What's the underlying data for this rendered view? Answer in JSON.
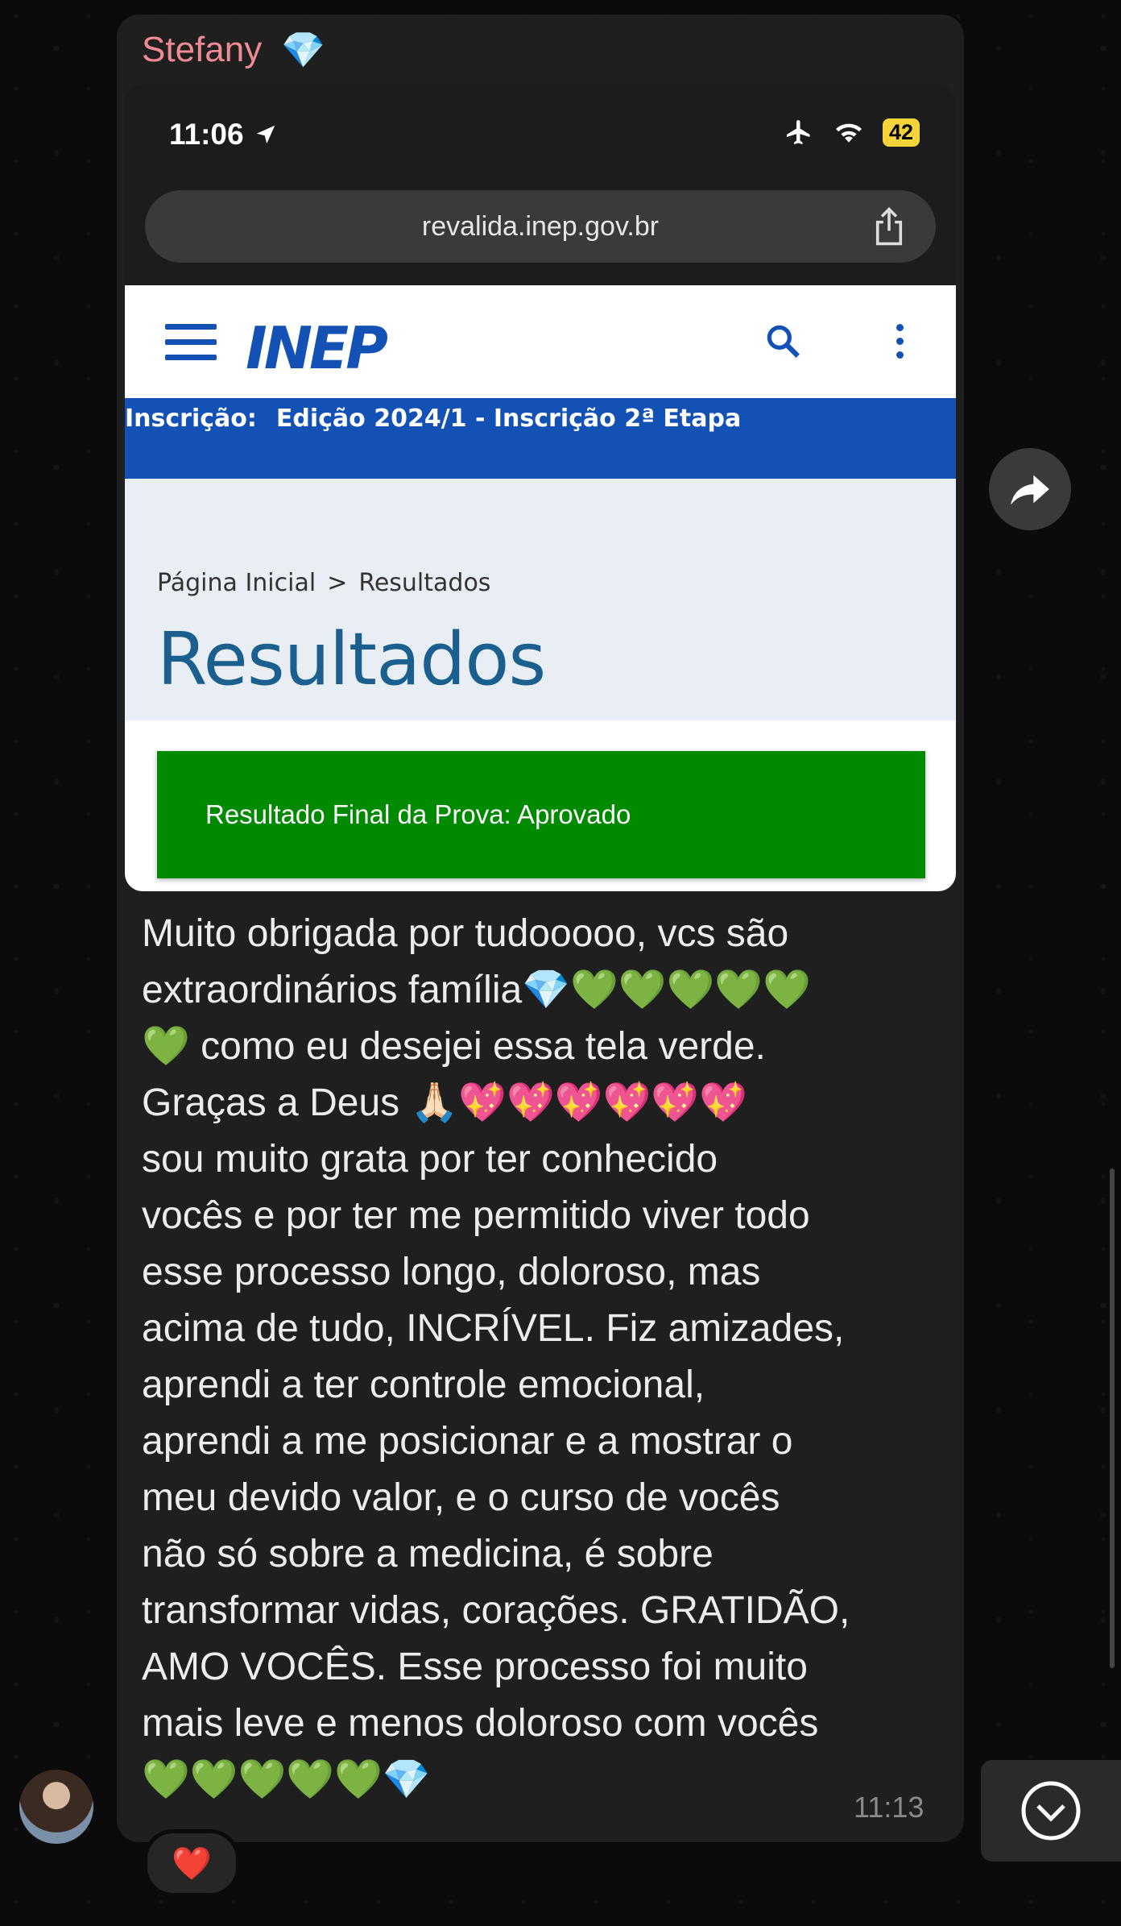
{
  "chat": {
    "sender_name": "Stefany",
    "sender_emoji": "💎",
    "message_text": "Muito obrigada por tudooooo, vcs são\nextraordinários família💎💚💚💚💚💚\n💚 como eu desejei essa tela verde.\nGraças a Deus 🙏🏻💖💖💖💖💖💖\nsou muito grata por ter conhecido\nvocês e por ter me permitido viver todo\nesse processo longo, doloroso, mas\nacima de tudo, INCRÍVEL. Fiz amizades,\naprendi a ter controle emocional,\naprendi a me posicionar e a mostrar o\nmeu devido valor, e o curso de vocês\nnão só sobre a medicina, é sobre\ntransformar vidas, corações. GRATIDÃO,\nAMO VOCÊS. Esse processo foi muito\nmais leve e menos doloroso com vocês\n💚💚💚💚💚💎",
    "time": "11:13",
    "reaction": "❤️"
  },
  "screenshot": {
    "status_time": "11:06",
    "battery": "42",
    "url": "revalida.inep.gov.br",
    "logo": "INEP",
    "band_label": "Inscrição:",
    "band_value": "Edição 2024/1 - Inscrição 2ª Etapa",
    "breadcrumb_home": "Página Inicial",
    "breadcrumb_sep": ">",
    "breadcrumb_current": "Resultados",
    "page_title": "Resultados",
    "result_text": "Resultado Final da Prova: Aprovado"
  },
  "colors": {
    "sender": "#f08a95",
    "inep_blue": "#1351b4",
    "result_green": "#008a00"
  },
  "icons": [
    "location-arrow-icon",
    "airplane-icon",
    "wifi-icon",
    "share-icon",
    "hamburger-icon",
    "search-icon",
    "more-vert-icon",
    "forward-icon",
    "chevron-down-icon"
  ]
}
